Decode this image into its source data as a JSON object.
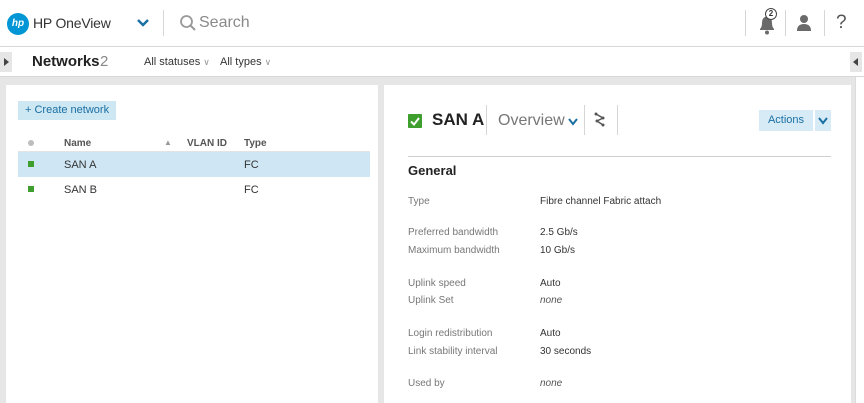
{
  "header": {
    "logo_text": "hp",
    "app_name": "HP OneView",
    "search_placeholder": "Search",
    "notification_count": "2",
    "help_label": "?"
  },
  "subheader": {
    "title": "Networks",
    "count": "2",
    "filters": [
      {
        "label": "All statuses"
      },
      {
        "label": "All types"
      }
    ]
  },
  "list_panel": {
    "create_button": "+ Create network",
    "columns": {
      "name": "Name",
      "sort_indicator": "▲",
      "vlan": "VLAN ID",
      "type": "Type"
    },
    "rows": [
      {
        "name": "SAN A",
        "vlan": "",
        "type": "FC",
        "status": "ok",
        "selected": true
      },
      {
        "name": "SAN B",
        "vlan": "",
        "type": "FC",
        "status": "ok",
        "selected": false
      }
    ]
  },
  "detail_panel": {
    "title": "SAN A",
    "view": "Overview",
    "actions_label": "Actions",
    "section": "General",
    "properties": [
      {
        "label": "Type",
        "value": "Fibre channel Fabric attach",
        "italic": false
      },
      {
        "label": "Preferred bandwidth",
        "value": "2.5 Gb/s",
        "italic": false
      },
      {
        "label": "Maximum bandwidth",
        "value": "10 Gb/s",
        "italic": false
      },
      {
        "label": "Uplink speed",
        "value": "Auto",
        "italic": false
      },
      {
        "label": "Uplink Set",
        "value": "none",
        "italic": true
      },
      {
        "label": "Login redistribution",
        "value": "Auto",
        "italic": false
      },
      {
        "label": "Link stability interval",
        "value": "30 seconds",
        "italic": false
      },
      {
        "label": "Used by",
        "value": "none",
        "italic": true
      }
    ]
  },
  "colors": {
    "accent": "#0096d6",
    "status_ok": "#3e9e2e",
    "selection": "#cfe7f5",
    "button_bg": "#d6ebf6"
  }
}
